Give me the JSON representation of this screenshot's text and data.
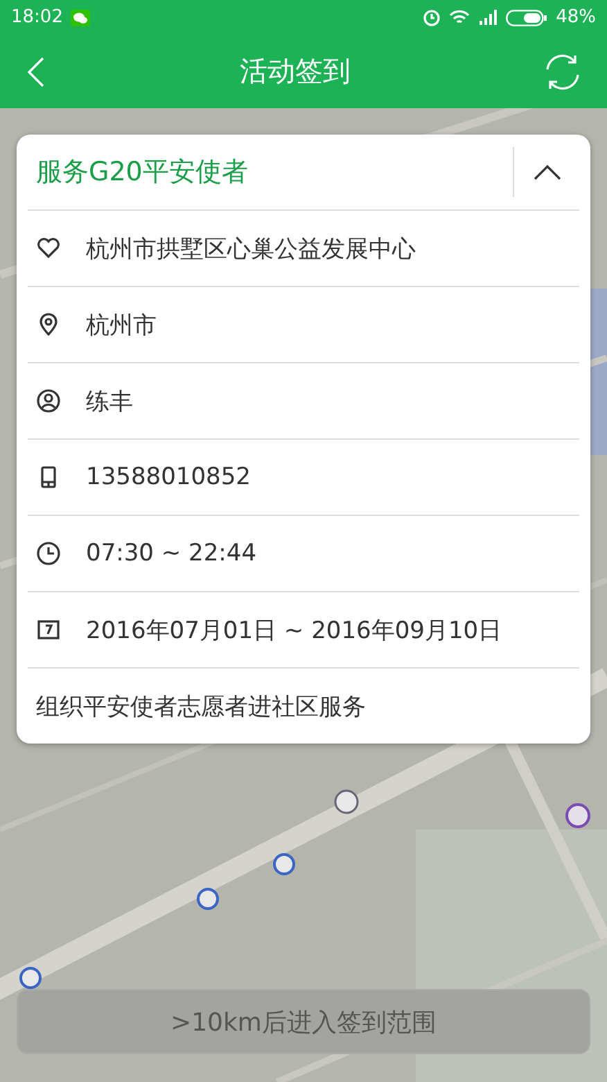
{
  "status_bar": {
    "time": "18:02",
    "battery": "48%"
  },
  "app_bar": {
    "title": "活动签到"
  },
  "event_card": {
    "title": "服务G20平安使者",
    "expanded": true,
    "rows": [
      {
        "kind": "organization",
        "text": "杭州市拱墅区心巢公益发展中心"
      },
      {
        "kind": "location",
        "text": "杭州市"
      },
      {
        "kind": "person",
        "text": "练丰"
      },
      {
        "kind": "phone",
        "text": "13588010852"
      },
      {
        "kind": "time",
        "text": "07:30 ~ 22:44"
      },
      {
        "kind": "date",
        "text": "2016年07月01日 ~ 2016年09月10日"
      }
    ],
    "description": "组织平安使者志愿者进社区服务"
  },
  "checkin_button": {
    "label": ">10km后进入签到范围",
    "disabled": true
  }
}
